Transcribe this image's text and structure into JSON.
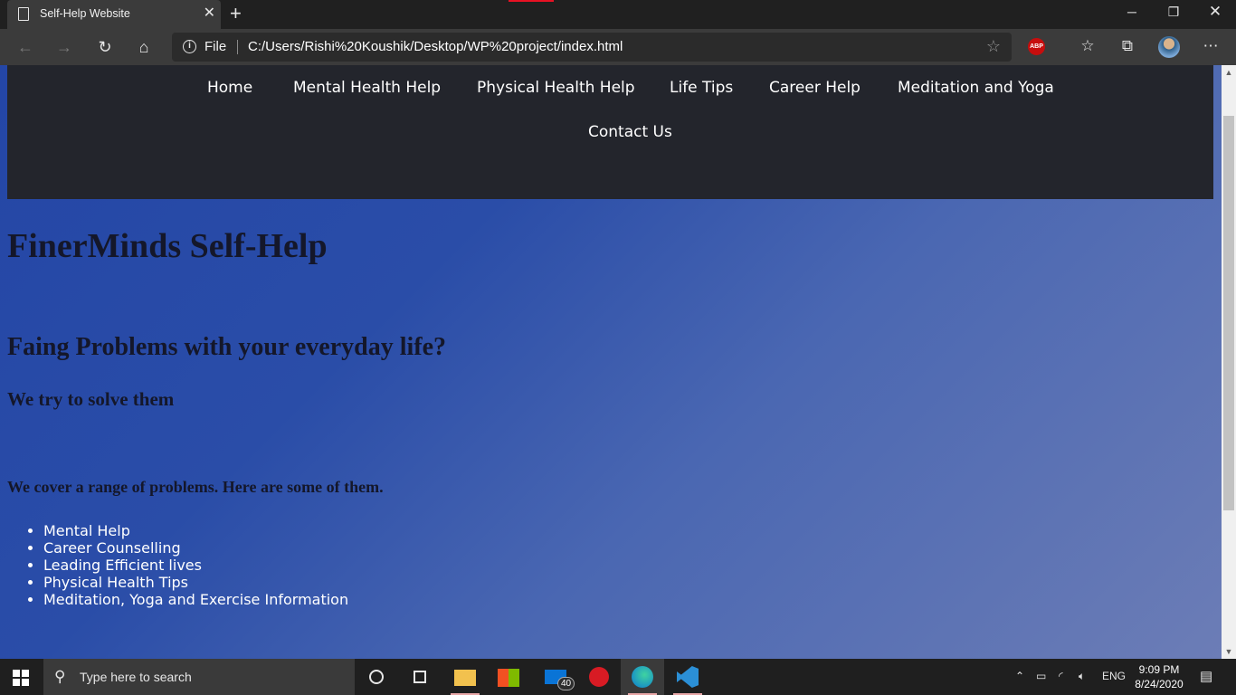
{
  "browser": {
    "tab_title": "Self-Help Website",
    "address_scheme": "File",
    "url": "C:/Users/Rishi%20Koushik/Desktop/WP%20project/index.html",
    "abp_label": "ABP"
  },
  "site": {
    "nav": [
      "Home",
      "Mental Health Help",
      "Physical Health Help",
      "Life Tips",
      "Career Help",
      "Meditation and Yoga",
      "Contact Us"
    ],
    "title": "FinerMinds Self-Help",
    "heading": "Faing Problems with your everyday life?",
    "subheading": "We try to solve them",
    "intro": "We cover a range of problems. Here are some of them.",
    "topics": [
      "Mental Help",
      "Career Counselling",
      "Leading Efficient lives",
      "Physical Health Tips",
      "Meditation, Yoga and Exercise Information"
    ]
  },
  "taskbar": {
    "search_placeholder": "Type here to search",
    "mail_badge": "40",
    "language": "ENG",
    "time": "9:09 PM",
    "date": "8/24/2020"
  },
  "colors": {
    "page_gradient_start": "#2446a6",
    "page_gradient_end": "#6c7db6",
    "site_nav_bg": "#23252c",
    "heading_color": "#14172a"
  }
}
